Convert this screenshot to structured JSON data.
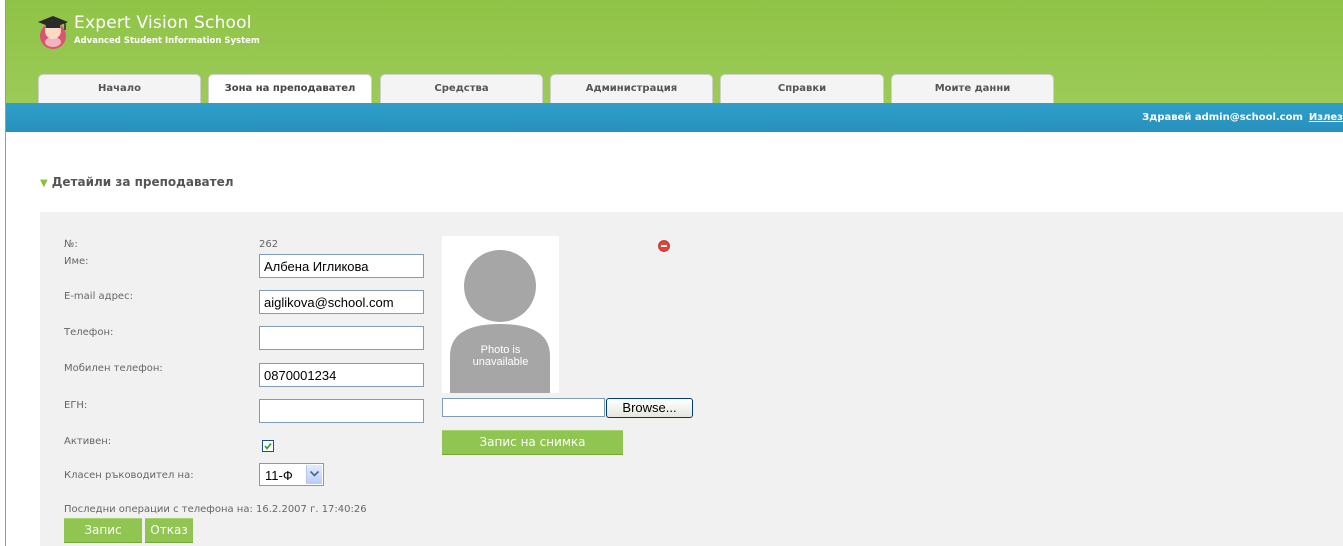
{
  "brand": {
    "title": "Expert Vision School",
    "subtitle": "Advanced Student Information System"
  },
  "nav": {
    "tabs": [
      {
        "label": "Начало",
        "active": false
      },
      {
        "label": "Зона на преподавател",
        "active": true
      },
      {
        "label": "Средства",
        "active": false
      },
      {
        "label": "Администрация",
        "active": false
      },
      {
        "label": "Справки",
        "active": false
      },
      {
        "label": "Моите данни",
        "active": false
      }
    ]
  },
  "userbar": {
    "greeting": "Здравей admin@school.com",
    "logout": "Излез"
  },
  "section": {
    "title": "Детайли за преподавател"
  },
  "form": {
    "number_label": "№:",
    "number_value": "262",
    "name_label": "Име:",
    "name_value": "Албена Игликова",
    "email_label": "E-mail адрес:",
    "email_value": "aiglikova@school.com",
    "phone_label": "Телефон:",
    "phone_value": "",
    "mobile_label": "Мобилен телефон:",
    "mobile_value": "0870001234",
    "egn_label": "ЕГН:",
    "egn_value": "",
    "active_label": "Активен:",
    "active_checked": true,
    "class_label": "Класен ръководител на:",
    "class_value": "11-Ф",
    "last_ops_label": "Последни операции с телефона на:",
    "last_ops_value": "16.2.2007 г. 17:40:26"
  },
  "photo": {
    "placeholder_line1": "Photo is",
    "placeholder_line2": "unavailable",
    "browse_label": "Browse...",
    "save_photo_label": "Запис на снимка"
  },
  "actions": {
    "save_label": "Запис",
    "cancel_label": "Отказ"
  },
  "colors": {
    "header_green": "#9ccb58",
    "bar_blue": "#2890bd",
    "button_green": "#90c552",
    "panel_gray": "#f1f1f1"
  }
}
